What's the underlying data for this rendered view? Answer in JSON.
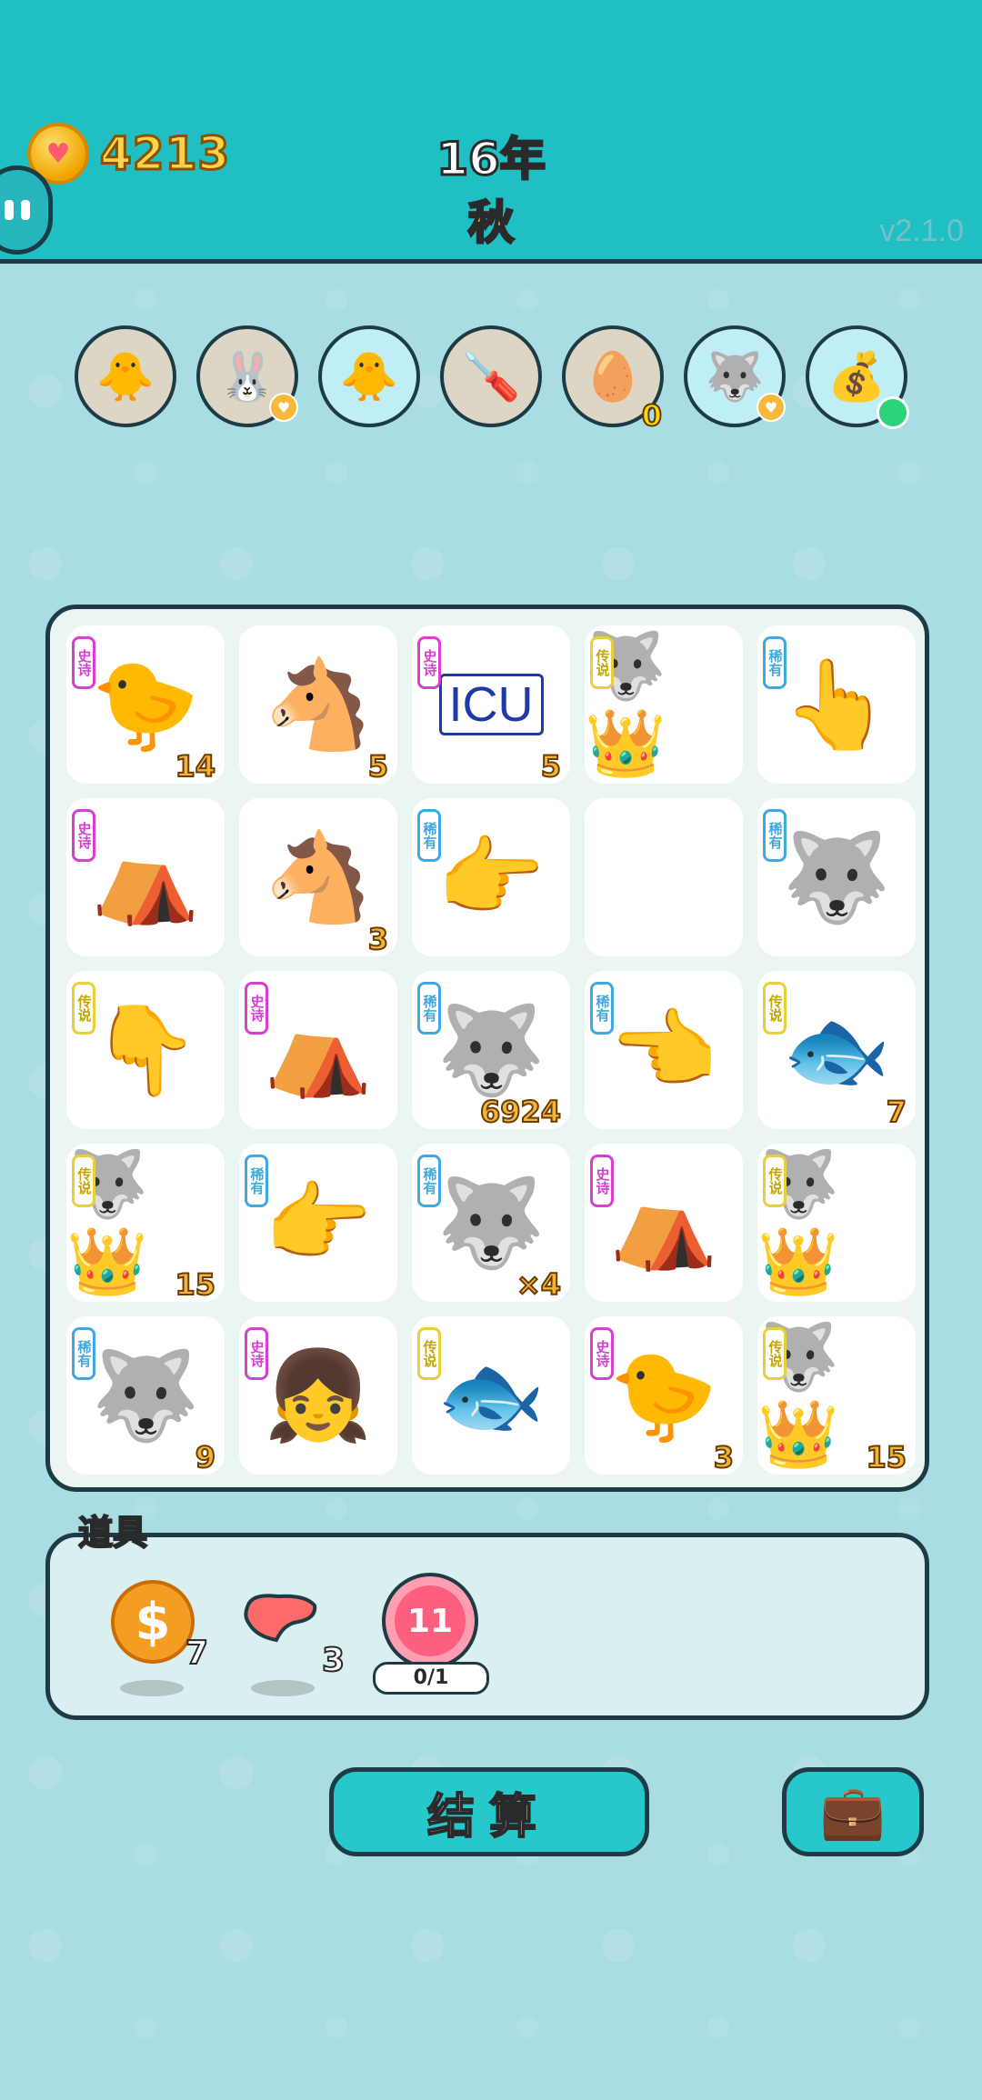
{
  "header": {
    "coins": "4213",
    "year": "16年",
    "season": "秋",
    "version": "v2.1.0"
  },
  "tools": [
    {
      "icon": "chick-egg-icon",
      "glyph": "🐥",
      "bg": "tan"
    },
    {
      "icon": "rabbit-icon",
      "glyph": "🐰",
      "bg": "tan",
      "heart": true
    },
    {
      "icon": "chick-egg-icon",
      "glyph": "🐥",
      "bg": "blue"
    },
    {
      "icon": "screwdriver-icon",
      "glyph": "🪛",
      "bg": "tan"
    },
    {
      "icon": "egg-carton-icon",
      "glyph": "🥚",
      "bg": "tan",
      "badge": "0"
    },
    {
      "icon": "husky-icon",
      "glyph": "🐺",
      "bg": "blue",
      "heart": true
    },
    {
      "icon": "bag-icon",
      "glyph": "💰",
      "bg": "blue",
      "dot": true
    }
  ],
  "board": [
    {
      "rarity": "史诗",
      "rtype": "epic",
      "glyph": "🐤",
      "count": "14"
    },
    {
      "glyph": "🐴",
      "count": "5"
    },
    {
      "rarity": "史诗",
      "rtype": "epic",
      "icu": "ICU",
      "count": "5"
    },
    {
      "rarity": "传说",
      "rtype": "legend",
      "glyph": "🐺👑",
      "count": ""
    },
    {
      "rarity": "稀有",
      "rtype": "rare",
      "glyph": "👆",
      "count": ""
    },
    {
      "rarity": "史诗",
      "rtype": "epic",
      "glyph": "⛺",
      "count": ""
    },
    {
      "glyph": "🐴",
      "count": "3"
    },
    {
      "rarity": "稀有",
      "rtype": "rare",
      "glyph": "👉",
      "count": ""
    },
    {
      "glyph": "",
      "count": ""
    },
    {
      "rarity": "稀有",
      "rtype": "rare",
      "glyph": "🐺",
      "count": ""
    },
    {
      "rarity": "传说",
      "rtype": "legend",
      "glyph": "👇",
      "count": ""
    },
    {
      "rarity": "史诗",
      "rtype": "epic",
      "glyph": "⛺",
      "count": ""
    },
    {
      "rarity": "稀有",
      "rtype": "rare",
      "glyph": "🐺",
      "count": "6924"
    },
    {
      "rarity": "稀有",
      "rtype": "rare",
      "glyph": "👈",
      "count": ""
    },
    {
      "rarity": "传说",
      "rtype": "legend",
      "glyph": "🐟",
      "count": "7"
    },
    {
      "rarity": "传说",
      "rtype": "legend",
      "glyph": "🐺👑",
      "count": "15"
    },
    {
      "rarity": "稀有",
      "rtype": "rare",
      "glyph": "👉",
      "count": ""
    },
    {
      "rarity": "稀有",
      "rtype": "rare",
      "glyph": "🐺",
      "count": "×4"
    },
    {
      "rarity": "史诗",
      "rtype": "epic",
      "glyph": "⛺",
      "count": ""
    },
    {
      "rarity": "传说",
      "rtype": "legend",
      "glyph": "🐺👑",
      "count": ""
    },
    {
      "rarity": "稀有",
      "rtype": "rare",
      "glyph": "🐺",
      "count": "9"
    },
    {
      "rarity": "史诗",
      "rtype": "epic",
      "glyph": "👧",
      "count": ""
    },
    {
      "rarity": "传说",
      "rtype": "legend",
      "glyph": "🐟",
      "count": ""
    },
    {
      "rarity": "史诗",
      "rtype": "epic",
      "glyph": "🐤",
      "count": "3"
    },
    {
      "rarity": "传说",
      "rtype": "legend",
      "glyph": "🐺👑",
      "count": "15"
    }
  ],
  "items": {
    "title": "道具",
    "coin": {
      "icon": "dollar-coin-icon",
      "symbol": "$",
      "count": "7"
    },
    "liver": {
      "icon": "liver-icon",
      "count": "3"
    },
    "target": {
      "icon": "target-icon",
      "value": "11",
      "progress": "0/1"
    }
  },
  "buttons": {
    "settle": "结算",
    "bag_icon": "briefcase-icon"
  },
  "colors": {
    "header_bg": "#1fbfc3",
    "page_bg": "#a9dde3",
    "outline": "#1d3b45",
    "epic": "#d63fd0",
    "legend": "#c6a600",
    "rare": "#3fa8e0"
  }
}
